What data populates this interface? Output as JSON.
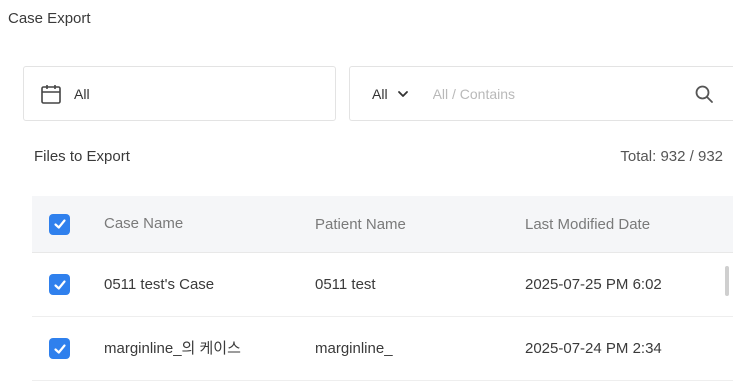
{
  "title": "Case Export",
  "date_filter": {
    "value": "All",
    "icon": "calendar-icon"
  },
  "search": {
    "scope": "All",
    "placeholder": "All / Contains",
    "icon": "search-icon"
  },
  "files_label": "Files to Export",
  "total": "Total: 932 / 932",
  "accent_color": "#2f80ed",
  "table": {
    "headers": {
      "case_name": "Case Name",
      "patient_name": "Patient Name",
      "last_modified": "Last Modified Date"
    },
    "header_checked": true,
    "rows": [
      {
        "checked": true,
        "case_name": "0511 test's Case",
        "patient_name": "0511 test",
        "last_modified": "2025-07-25 PM 6:02"
      },
      {
        "checked": true,
        "case_name": "marginline_의 케이스",
        "patient_name": "marginline_",
        "last_modified": "2025-07-24 PM 2:34"
      }
    ]
  }
}
